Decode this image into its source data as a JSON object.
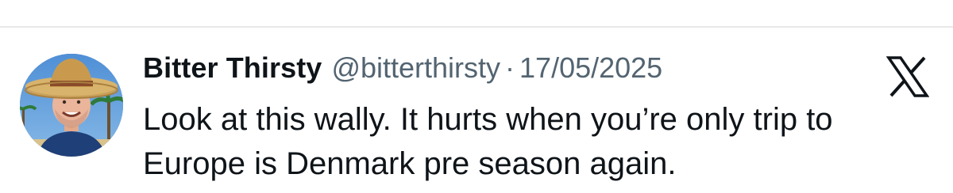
{
  "tweet": {
    "author": {
      "display_name": "Bitter Thirsty",
      "handle": "@bitterthirsty",
      "avatar_icon": "avatar-person-sombrero"
    },
    "separator": "·",
    "date": "17/05/2025",
    "platform_icon": "x-logo-icon",
    "text_lines": [
      "Look at this wally. It hurts when you’re only trip to",
      "Europe is Denmark pre season again."
    ]
  },
  "colors": {
    "text_primary": "#0f1419",
    "text_secondary": "#536471",
    "divider": "#e6e8ea",
    "background": "#ffffff"
  }
}
